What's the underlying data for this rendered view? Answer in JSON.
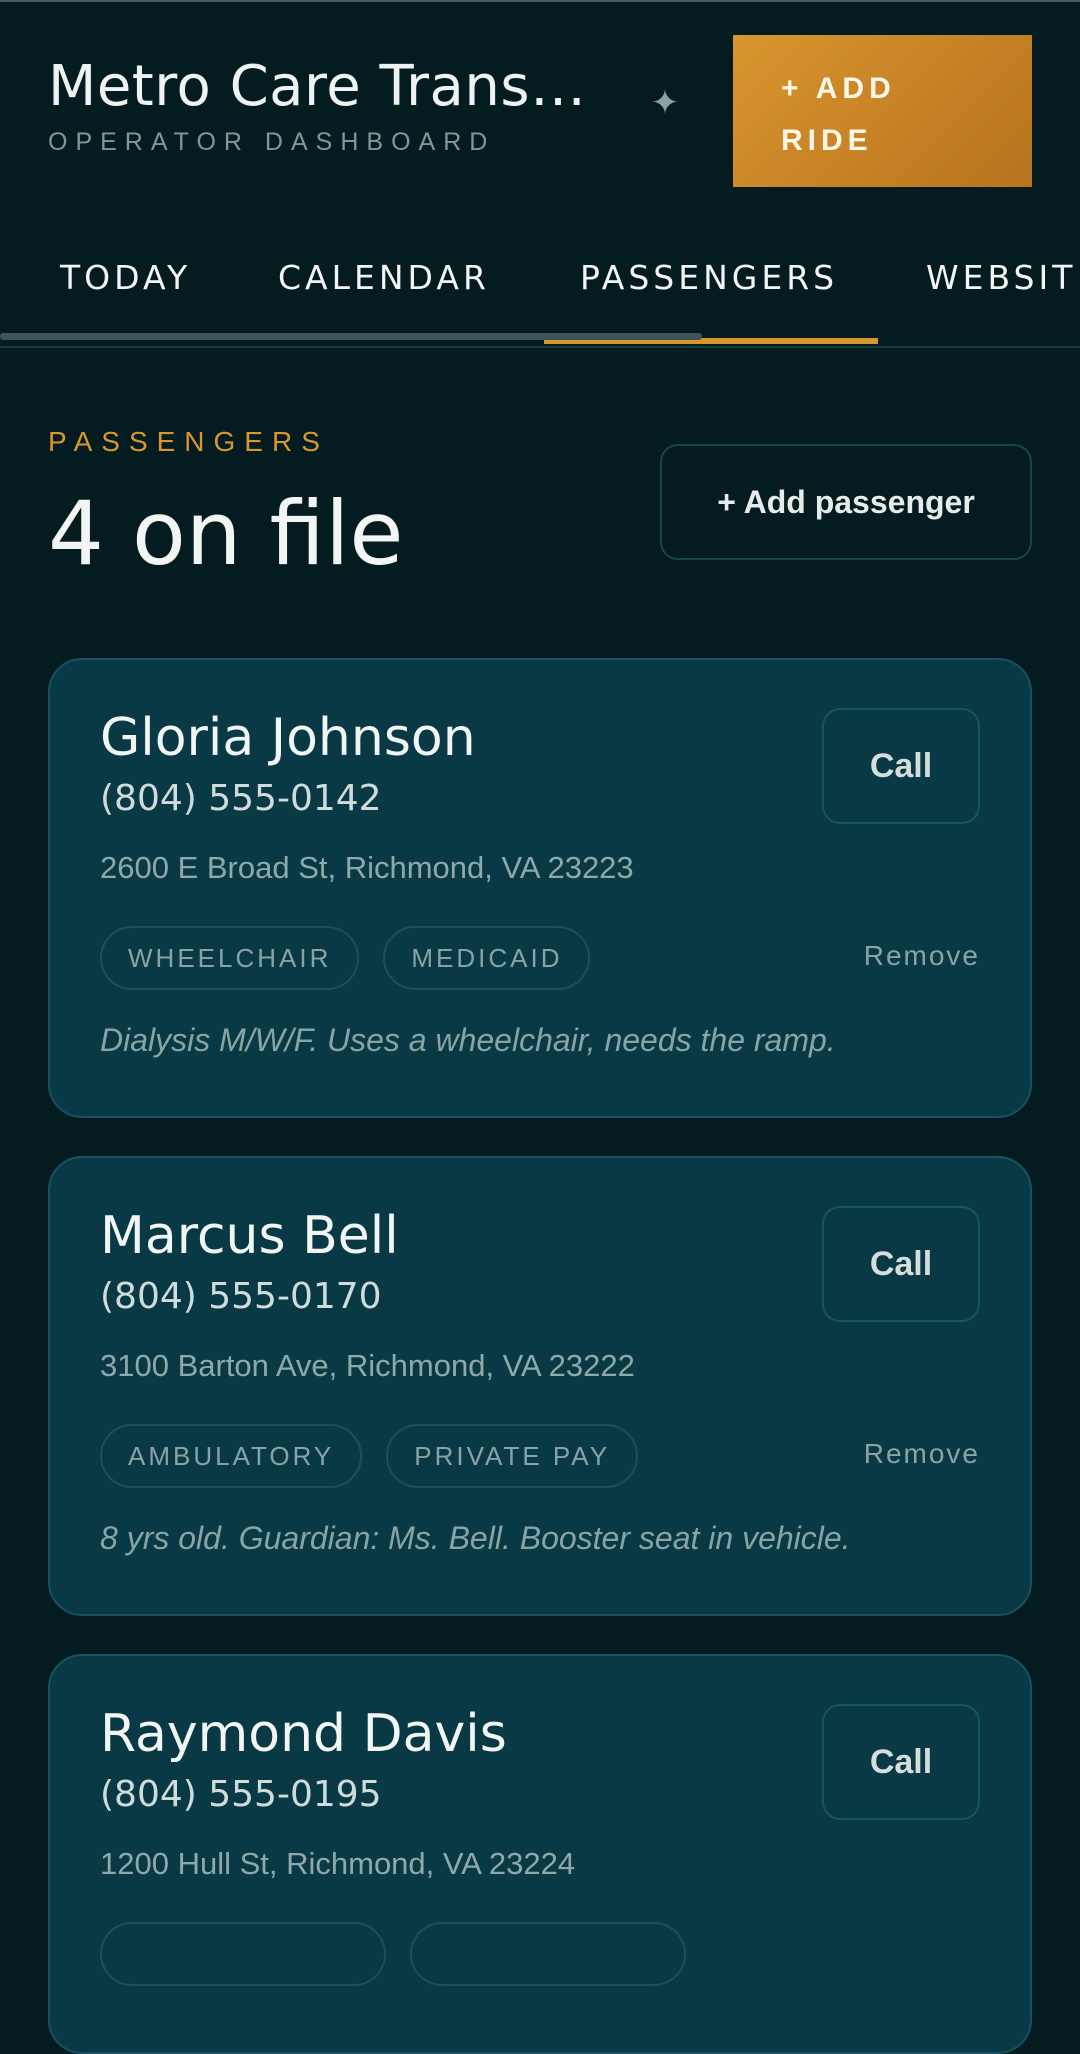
{
  "header": {
    "title": "Metro Care Transp...",
    "subtitle": "OPERATOR DASHBOARD",
    "add_ride_label": "+ ADD\nRIDE"
  },
  "tabs": [
    {
      "label": "TODAY",
      "active": false
    },
    {
      "label": "CALENDAR",
      "active": false
    },
    {
      "label": "PASSENGERS",
      "active": true
    },
    {
      "label": "WEBSIT",
      "active": false
    }
  ],
  "section": {
    "kicker": "PASSENGERS",
    "count_label": "4 on file",
    "add_passenger_label": "+ Add passenger"
  },
  "passengers": [
    {
      "name": "Gloria Johnson",
      "phone": "(804) 555-0142",
      "address": "2600 E Broad St, Richmond, VA 23223",
      "tags": [
        "WHEELCHAIR",
        "MEDICAID"
      ],
      "note": "Dialysis M/W/F. Uses a wheelchair, needs the ramp."
    },
    {
      "name": "Marcus Bell",
      "phone": "(804) 555-0170",
      "address": "3100 Barton Ave, Richmond, VA 23222",
      "tags": [
        "AMBULATORY",
        "PRIVATE PAY"
      ],
      "note": "8 yrs old. Guardian: Ms. Bell. Booster seat in vehicle."
    },
    {
      "name": "Raymond Davis",
      "phone": "(804) 555-0195",
      "address": "1200 Hull St, Richmond, VA 23224",
      "tags": [
        "",
        ""
      ],
      "note": ""
    }
  ],
  "labels": {
    "call": "Call",
    "remove": "Remove"
  },
  "icons": {
    "sparkle": "sparkle-icon"
  },
  "colors": {
    "accent": "#d8962f",
    "background": "#041c1f",
    "card": "#093945"
  }
}
